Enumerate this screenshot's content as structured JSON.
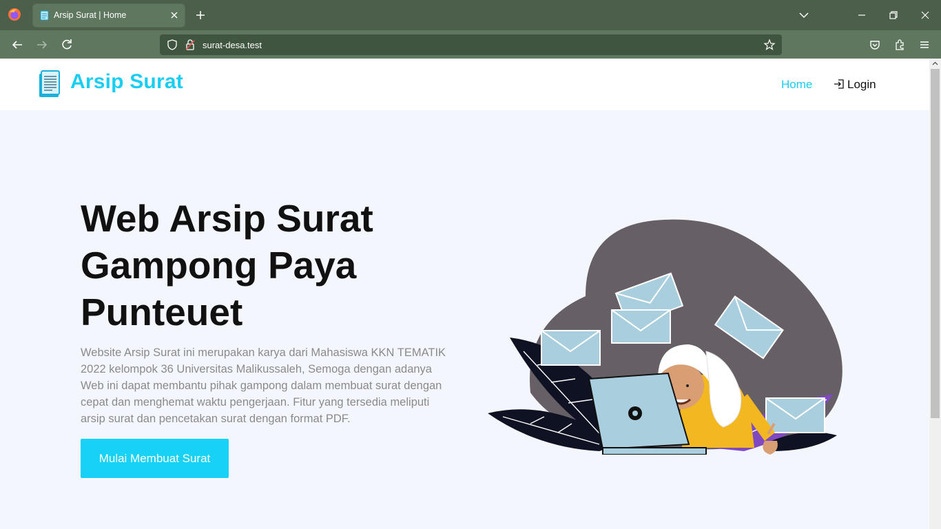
{
  "browser": {
    "tab_title": "Arsip Surat | Home",
    "url": "surat-desa.test"
  },
  "site": {
    "brand": "Arsip Surat",
    "nav": {
      "home": "Home",
      "login": "Login"
    }
  },
  "hero": {
    "title_line1": "Web Arsip Surat",
    "title_line2": "Gampong Paya",
    "title_line3": "Punteuet",
    "description": "Website Arsip Surat ini merupakan karya dari Mahasiswa KKN TEMATIK 2022 kelompok 36 Universitas Malikussaleh, Semoga dengan adanya Web ini dapat membantu pihak gampong dalam membuat surat dengan cepat dan menghemat waktu pengerjaan. Fitur yang tersedia meliputi arsip surat dan pencetakan surat dengan format PDF.",
    "cta": "Mulai Membuat Surat"
  },
  "colors": {
    "accent": "#1acdf2",
    "button": "#18d2f5",
    "browser_chrome": "#4b5f4b",
    "page_bg": "#f3f7fd"
  },
  "icons": [
    "firefox-icon",
    "document-favicon",
    "close-icon",
    "plus-icon",
    "chevron-down-icon",
    "minimize-icon",
    "restore-icon",
    "close-window-icon",
    "back-icon",
    "forward-icon",
    "reload-icon",
    "shield-icon",
    "lock-icon",
    "star-icon",
    "pocket-icon",
    "extensions-icon",
    "menu-icon",
    "login-icon",
    "document-logo-icon"
  ]
}
